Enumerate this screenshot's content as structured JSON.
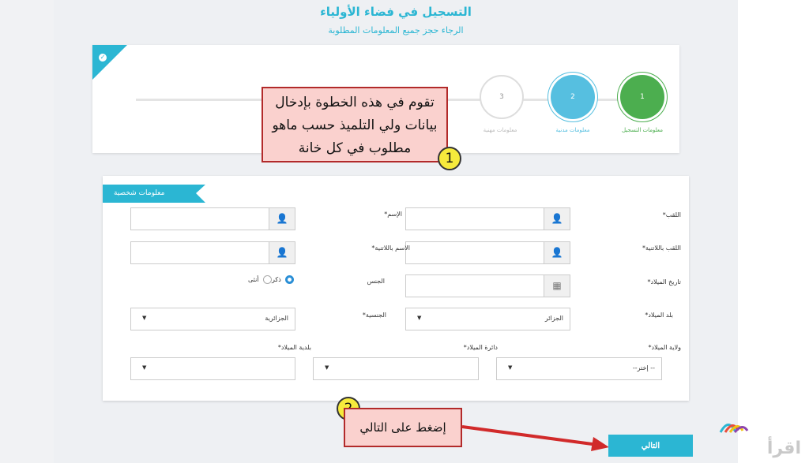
{
  "header": {
    "title": "التسجيل في فضاء الأولياء",
    "subtitle": "الرجاء حجز جميع المعلومات المطلوبة"
  },
  "wizard": {
    "steps": [
      {
        "number": "1",
        "label": "معلومات التسجيل",
        "state": "done"
      },
      {
        "number": "2",
        "label": "معلومات مدنية",
        "state": "active"
      },
      {
        "number": "3",
        "label": "معلومات مهنية",
        "state": "pending"
      }
    ]
  },
  "form": {
    "section_title": "معلومات شخصية",
    "fields": {
      "last_name": {
        "label": "اللقب*",
        "value": ""
      },
      "first_name": {
        "label": "الإسم*",
        "value": ""
      },
      "last_name_latin": {
        "label": "اللقب باللاتنية*",
        "value": ""
      },
      "first_name_latin": {
        "label": "الاسم باللاتنية*",
        "value": ""
      },
      "birth_date": {
        "label": "تاريخ الميلاد*",
        "value": ""
      },
      "gender": {
        "label": "الجنس",
        "options": [
          "ذكر",
          "أنثى"
        ],
        "selected": "ذكر"
      },
      "birth_country": {
        "label": "بلد الميلاد*",
        "value": "الجزائر"
      },
      "nationality": {
        "label": "الجنسية*",
        "value": "الجزائرية"
      },
      "birth_wilaya": {
        "label": "ولاية الميلاد*",
        "value": "--إختر --"
      },
      "birth_daira": {
        "label": "دائرة الميلاد*",
        "value": ""
      },
      "birth_commune": {
        "label": "بلدية الميلاد*",
        "value": ""
      }
    },
    "next_button": "التالي"
  },
  "annotations": {
    "badge1": "1",
    "callout1": "تقوم في هذه الخطوة بإدخال بيانات ولي التلميذ حسب ماهو مطلوب في كل خانة",
    "badge2": "2",
    "callout2": "إضغط على التالي"
  },
  "watermark": "اقرأ",
  "colors": {
    "accent": "#2bb6d3",
    "step_done": "#4cae4f",
    "step_active": "#56bfe0",
    "callout_fill": "#fad1ce",
    "callout_border": "#b22a2a",
    "badge": "#f6ea3c"
  },
  "icons": [
    "check-icon",
    "user-icon",
    "calendar-icon",
    "caret-down-icon"
  ]
}
